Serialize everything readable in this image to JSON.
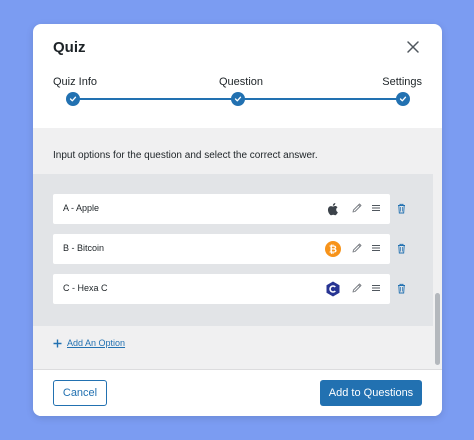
{
  "modal": {
    "title": "Quiz",
    "close_icon": "close-icon"
  },
  "stepper": {
    "steps": [
      {
        "label": "Quiz Info",
        "completed": true
      },
      {
        "label": "Question",
        "completed": true
      },
      {
        "label": "Settings",
        "completed": true
      }
    ],
    "accent_color": "#2271b1"
  },
  "content": {
    "instruction": "Input options for the question and select the correct answer.",
    "options": [
      {
        "label": "A - Apple",
        "icon": "apple-icon"
      },
      {
        "label": "B - Bitcoin",
        "icon": "bitcoin-icon"
      },
      {
        "label": "C - Hexa C",
        "icon": "c-language-icon"
      }
    ],
    "add_option_label": "Add An Option"
  },
  "footer": {
    "cancel_label": "Cancel",
    "submit_label": "Add to Questions"
  },
  "colors": {
    "background": "#7b9cf2",
    "primary": "#2271b1",
    "bitcoin": "#f7931a",
    "c_language": "#283593"
  }
}
